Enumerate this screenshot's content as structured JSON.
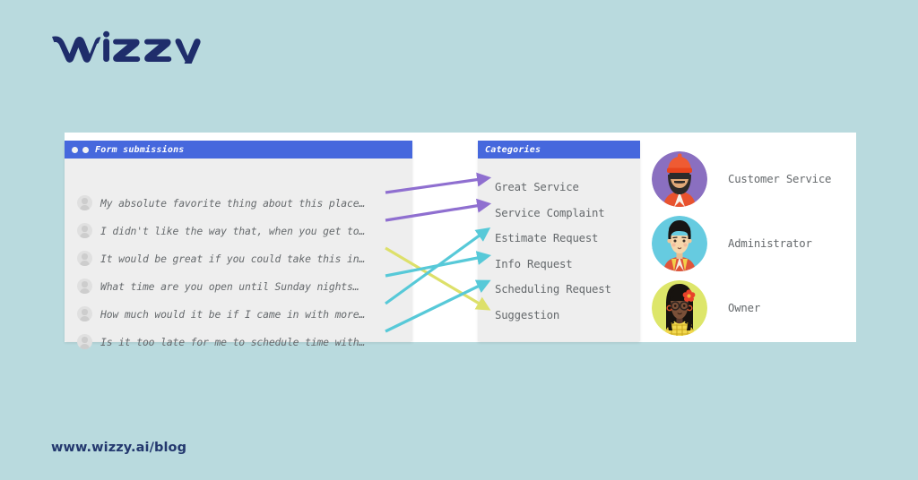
{
  "brand": {
    "logo_text": "wizzy",
    "logo_color": "#1f2d6b",
    "footer_url": "www.wizzy.ai/blog",
    "footer_color": "#23386e",
    "page_background": "#b9dade",
    "card_background": "#ffffff"
  },
  "submissions_panel": {
    "title": "Form submissions",
    "header_color": "#4668dd",
    "body_color": "#eeeeee",
    "window_dots": 2,
    "rows": [
      {
        "text": "My absolute favorite thing about this place…"
      },
      {
        "text": "I didn't like the way that, when you get to…"
      },
      {
        "text": "It would be great if you could take this in…"
      },
      {
        "text": "What time are you open until Sunday nights…"
      },
      {
        "text": "How much would it be if I came in with more…"
      },
      {
        "text": "Is it too late for me to schedule time with…"
      }
    ]
  },
  "categories_panel": {
    "title": "Categories",
    "header_color": "#4668dd",
    "body_color": "#eeeeee",
    "items": [
      {
        "label": "Great Service"
      },
      {
        "label": "Service Complaint"
      },
      {
        "label": "Estimate Request"
      },
      {
        "label": "Info Request"
      },
      {
        "label": "Scheduling Request"
      },
      {
        "label": "Suggestion"
      }
    ]
  },
  "connections": [
    {
      "from_row": 0,
      "to_category": 0,
      "color": "#8f6fd0"
    },
    {
      "from_row": 1,
      "to_category": 1,
      "color": "#8f6fd0"
    },
    {
      "from_row": 2,
      "to_category": 5,
      "color": "#dde06a"
    },
    {
      "from_row": 3,
      "to_category": 3,
      "color": "#57c9d8"
    },
    {
      "from_row": 4,
      "to_category": 2,
      "color": "#57c9d8"
    },
    {
      "from_row": 5,
      "to_category": 4,
      "color": "#57c9d8"
    }
  ],
  "roles": [
    {
      "label": "Customer Service",
      "avatar": "bearded-person-in-beanie-with-sunglasses-avatar",
      "background": "#8a6fc0"
    },
    {
      "label": "Administrator",
      "avatar": "short-black-hair-person-avatar",
      "background": "#66cbe0"
    },
    {
      "label": "Owner",
      "avatar": "long-black-hair-person-with-glasses-and-flower-avatar",
      "background": "#dde66a"
    }
  ]
}
